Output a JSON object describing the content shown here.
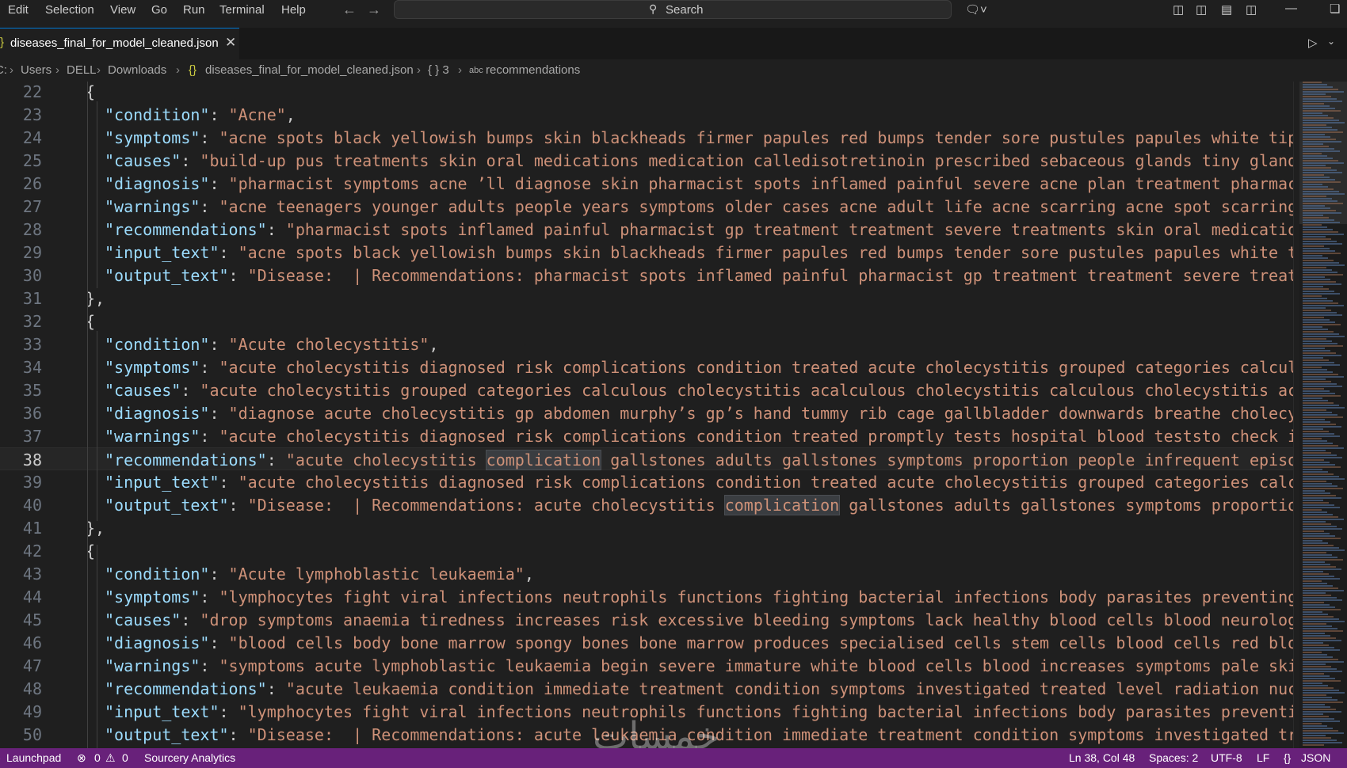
{
  "menu": [
    "Edit",
    "Selection",
    "View",
    "Go",
    "Run",
    "Terminal",
    "Help"
  ],
  "search": {
    "label": "Search"
  },
  "tab": {
    "filename": "diseases_final_for_model_cleaned.json"
  },
  "breadcrumb": {
    "drive": "C:",
    "users": "Users",
    "user": "DELL",
    "downloads": "Downloads",
    "file": "diseases_final_for_model_cleaned.json",
    "object": "{ } 3",
    "property": "recommendations"
  },
  "editor": {
    "highlight_word": "complication",
    "lines": [
      {
        "n": "22",
        "key": "",
        "val": "",
        "raw": "{",
        "indent": 1
      },
      {
        "n": "23",
        "key": "\"condition\"",
        "val": "\"Acne\"",
        "tail": ",",
        "indent": 2
      },
      {
        "n": "24",
        "key": "\"symptoms\"",
        "val": "\"acne spots black yellowish bumps skin blackheads firmer papules red bumps tender sore pustules papules white tip",
        "indent": 2
      },
      {
        "n": "25",
        "key": "\"causes\"",
        "val": "\"build-up pus treatments skin oral medications medication calledisotretinoin prescribed sebaceous glands tiny glands",
        "indent": 2
      },
      {
        "n": "26",
        "key": "\"diagnosis\"",
        "val": "\"pharmacist symptoms acne ’ll diagnose skin pharmacist spots inflamed painful severe acne plan treatment pharmaci",
        "indent": 2
      },
      {
        "n": "27",
        "key": "\"warnings\"",
        "val": "\"acne teenagers younger adults people years symptoms older cases acne adult life acne scarring acne spot scarring",
        "indent": 2
      },
      {
        "n": "28",
        "key": "\"recommendations\"",
        "val": "\"pharmacist spots inflamed painful pharmacist gp treatment treatment severe treatments skin oral medication",
        "indent": 2
      },
      {
        "n": "29",
        "key": "\"input_text\"",
        "val": "\"acne spots black yellowish bumps skin blackheads firmer papules red bumps tender sore pustules papules white ti",
        "indent": 2
      },
      {
        "n": "30",
        "key": "\"output_text\"",
        "val": "\"Disease:  | Recommendations: pharmacist spots inflamed painful pharmacist gp treatment treatment severe treatm",
        "indent": 2
      },
      {
        "n": "31",
        "key": "",
        "val": "",
        "raw": "},",
        "indent": 1
      },
      {
        "n": "32",
        "key": "",
        "val": "",
        "raw": "{",
        "indent": 1
      },
      {
        "n": "33",
        "key": "\"condition\"",
        "val": "\"Acute cholecystitis\"",
        "tail": ",",
        "indent": 2
      },
      {
        "n": "34",
        "key": "\"symptoms\"",
        "val": "\"acute cholecystitis diagnosed risk complications condition treated acute cholecystitis grouped categories calculo",
        "indent": 2
      },
      {
        "n": "35",
        "key": "\"causes\"",
        "val": "\"acute cholecystitis grouped categories calculous cholecystitis acalculous cholecystitis calculous cholecystitis acu",
        "indent": 2
      },
      {
        "n": "36",
        "key": "\"diagnosis\"",
        "val": "\"diagnose acute cholecystitis gp abdomen murphy’s gp’s hand tummy rib cage gallbladder downwards breathe cholecys",
        "indent": 2
      },
      {
        "n": "37",
        "key": "\"warnings\"",
        "val": "\"acute cholecystitis diagnosed risk complications condition treated promptly tests hospital blood teststo check in",
        "indent": 2
      },
      {
        "n": "38",
        "key": "\"recommendations\"",
        "val": "\"acute cholecystitis complication gallstones adults gallstones symptoms proportion people infrequent episod",
        "indent": 2,
        "current": true
      },
      {
        "n": "39",
        "key": "\"input_text\"",
        "val": "\"acute cholecystitis diagnosed risk complications condition treated acute cholecystitis grouped categories calcu",
        "indent": 2
      },
      {
        "n": "40",
        "key": "\"output_text\"",
        "val": "\"Disease:  | Recommendations: acute cholecystitis complication gallstones adults gallstones symptoms proportion",
        "indent": 2
      },
      {
        "n": "41",
        "key": "",
        "val": "",
        "raw": "},",
        "indent": 1
      },
      {
        "n": "42",
        "key": "",
        "val": "",
        "raw": "{",
        "indent": 1
      },
      {
        "n": "43",
        "key": "\"condition\"",
        "val": "\"Acute lymphoblastic leukaemia\"",
        "tail": ",",
        "indent": 2
      },
      {
        "n": "44",
        "key": "\"symptoms\"",
        "val": "\"lymphocytes fight viral infections neutrophils functions fighting bacterial infections body parasites preventing",
        "indent": 2
      },
      {
        "n": "45",
        "key": "\"causes\"",
        "val": "\"drop symptoms anaemia tiredness increases risk excessive bleeding symptoms lack healthy blood cells blood neurologi",
        "indent": 2
      },
      {
        "n": "46",
        "key": "\"diagnosis\"",
        "val": "\"blood cells body bone marrow spongy bones bone marrow produces specialised cells stem cells blood cells red bloo",
        "indent": 2
      },
      {
        "n": "47",
        "key": "\"warnings\"",
        "val": "\"symptoms acute lymphoblastic leukaemia begin severe immature white blood cells blood increases symptoms pale skin",
        "indent": 2
      },
      {
        "n": "48",
        "key": "\"recommendations\"",
        "val": "\"acute leukaemia condition immediate treatment condition symptoms investigated treated level radiation nucl",
        "indent": 2
      },
      {
        "n": "49",
        "key": "\"input_text\"",
        "val": "\"lymphocytes fight viral infections neutrophils functions fighting bacterial infections body parasites preventin",
        "indent": 2
      },
      {
        "n": "50",
        "key": "\"output_text\"",
        "val": "\"Disease:  | Recommendations: acute leukaemia condition immediate treatment condition symptoms investigated tre",
        "indent": 2
      }
    ]
  },
  "statusbar": {
    "launchpad": "Launchpad",
    "errors": "0",
    "warnings": "0",
    "analytics": "Sourcery Analytics",
    "position": "Ln 38, Col 48",
    "spaces": "Spaces: 2",
    "encoding": "UTF-8",
    "eol": "LF",
    "language": "JSON"
  },
  "watermark": "خمسات",
  "colors": {
    "statusbar": "#68217a",
    "key": "#9cdcfe",
    "string": "#ce9178",
    "editor_bg": "#1f1f1f"
  }
}
